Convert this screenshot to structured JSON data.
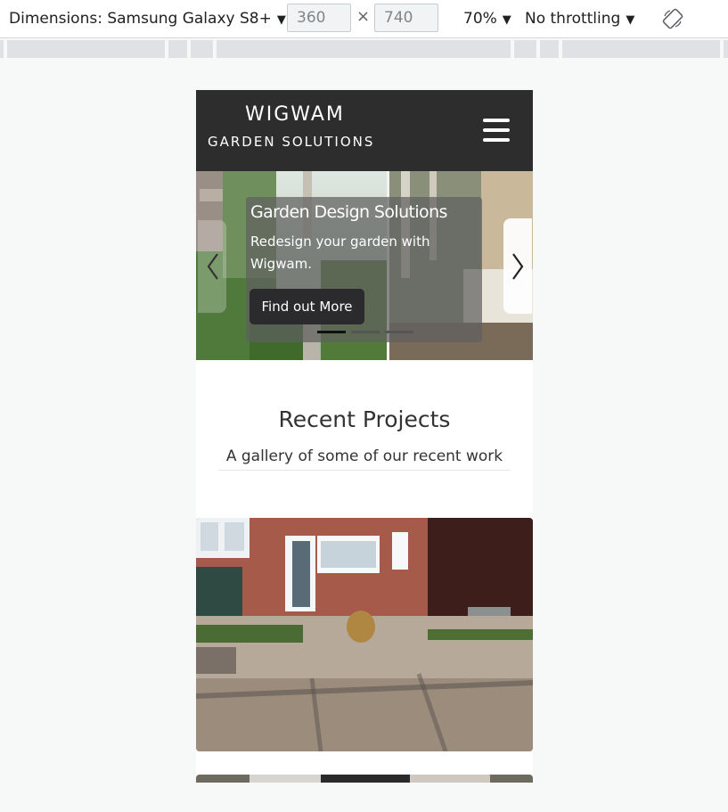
{
  "devtools": {
    "dimensions_label": "Dimensions: Samsung Galaxy S8+",
    "width_value": "360",
    "height_value": "740",
    "times_symbol": "×",
    "zoom": "70%",
    "throttling": "No throttling",
    "caret": "▼"
  },
  "site": {
    "brand_title": "WIGWAM",
    "brand_subtitle": "GARDEN SOLUTIONS",
    "header_color": "#2e2d2d"
  },
  "carousel": {
    "caption_title": "Garden Design Solutions",
    "caption_text": "Redesign your garden with Wigwam.",
    "button_label": "Find out More",
    "slide_count": 3,
    "active_slide": 1
  },
  "projects": {
    "title": "Recent Projects",
    "subtitle": "A gallery of some of our recent work"
  },
  "icons": {
    "rotate": "rotate-icon",
    "menu": "hamburger-icon",
    "prev": "chevron-left-icon",
    "next": "chevron-right-icon"
  }
}
